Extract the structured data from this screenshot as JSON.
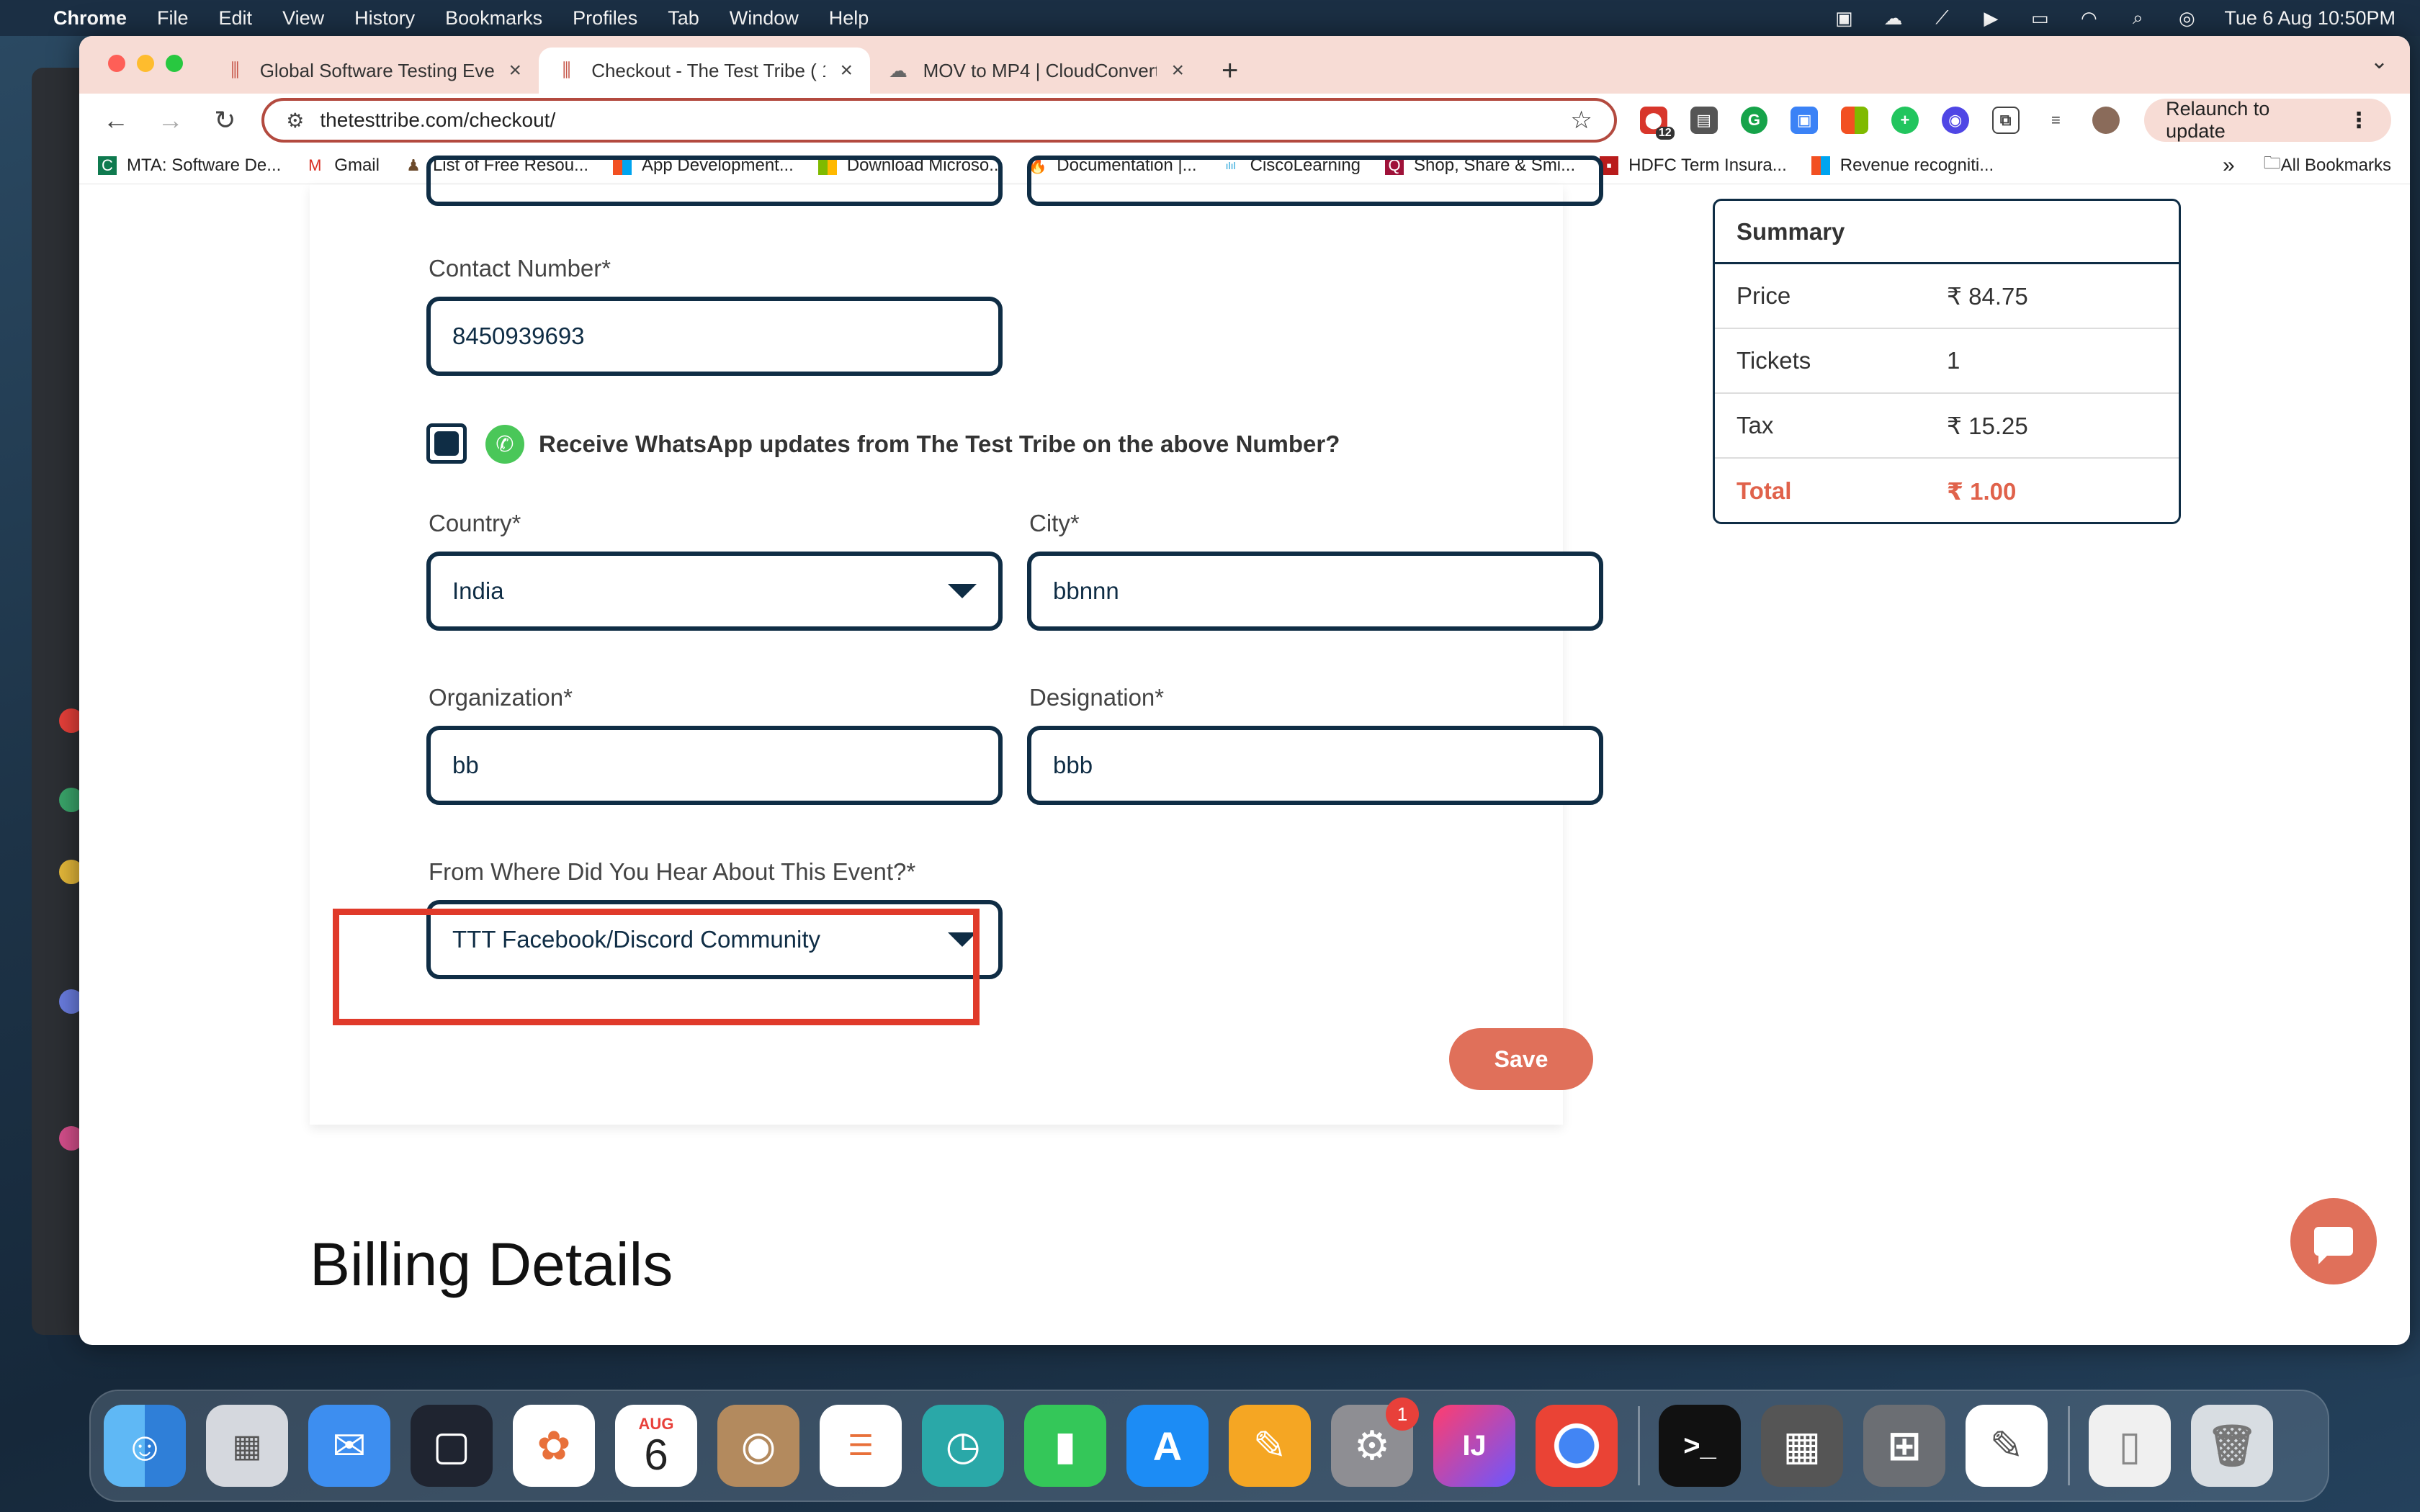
{
  "menubar": {
    "app": "Chrome",
    "items": [
      "File",
      "Edit",
      "View",
      "History",
      "Bookmarks",
      "Profiles",
      "Tab",
      "Window",
      "Help"
    ],
    "clock": "Tue 6 Aug  10:50PM"
  },
  "tabs": [
    {
      "title": "Global Software Testing Even"
    },
    {
      "title": "Checkout - The Test Tribe ( 1"
    },
    {
      "title": "MOV to MP4 | CloudConvert"
    }
  ],
  "toolbar": {
    "url": "thetesttribe.com/checkout/",
    "extension_badge": "12",
    "relaunch_label": "Relaunch to update"
  },
  "bookmarks": {
    "items": [
      {
        "label": "MTA: Software De..."
      },
      {
        "label": "Gmail"
      },
      {
        "label": "List of Free Resou..."
      },
      {
        "label": "App Development..."
      },
      {
        "label": "Download Microso..."
      },
      {
        "label": "Documentation  |..."
      },
      {
        "label": "CiscoLearning"
      },
      {
        "label": "Shop, Share & Smi..."
      },
      {
        "label": "HDFC Term Insura..."
      },
      {
        "label": "Revenue recogniti..."
      }
    ],
    "all_label": "All Bookmarks"
  },
  "form": {
    "contact_label": "Contact Number*",
    "contact_value": "8450939693",
    "whatsapp_label": "Receive WhatsApp updates from The Test Tribe on the above Number?",
    "country_label": "Country*",
    "country_value": "India",
    "city_label": "City*",
    "city_value": "bbnnn",
    "org_label": "Organization*",
    "org_value": "bb",
    "designation_label": "Designation*",
    "designation_value": "bbb",
    "source_label": "From Where Did You Hear About This Event?*",
    "source_value": "TTT Facebook/Discord Community",
    "save_label": "Save"
  },
  "billing_title": "Billing Details",
  "summary": {
    "title": "Summary",
    "rows": [
      {
        "key": "Price",
        "value": "₹ 84.75"
      },
      {
        "key": "Tickets",
        "value": "1"
      },
      {
        "key": "Tax",
        "value": "₹ 15.25"
      },
      {
        "key": "Total",
        "value": "₹ 1.00"
      }
    ]
  },
  "dock": {
    "calendar_month": "AUG",
    "calendar_day": "6",
    "settings_badge": "1",
    "intellij_label": "IJ"
  }
}
